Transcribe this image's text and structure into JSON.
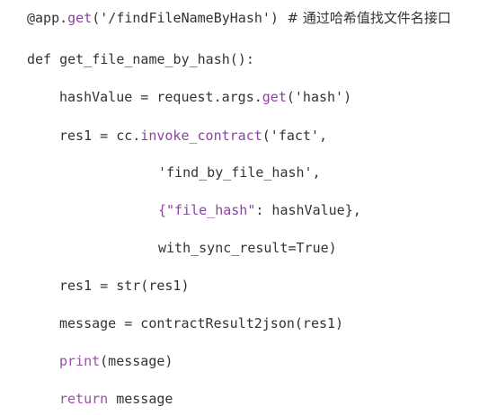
{
  "code": {
    "line0": {
      "decorator": "@app.",
      "method": "get",
      "args": "('/findFileNameByHash')",
      "comment": "  # 通过哈希值找文件名接口"
    },
    "line1": {
      "text": "def get_file_name_by_hash():"
    },
    "line2": {
      "lhs": "hashValue = request.args.",
      "method": "get",
      "args": "('hash')"
    },
    "line3": {
      "lhs": "res1 = cc.",
      "method": "invoke_contract",
      "args": "('fact',"
    },
    "line4": {
      "text": "'find_by_file_hash',"
    },
    "line5": {
      "open": "{",
      "key": "\"file_hash\"",
      "rest": ": hashValue},"
    },
    "line6": {
      "text": "with_sync_result=True)"
    },
    "line7": {
      "text": "res1 = str(res1)"
    },
    "line8": {
      "text": "message = contractResult2json(res1)"
    },
    "line9": {
      "func": "print",
      "args": "(message)"
    },
    "line10": {
      "keyword": "return",
      "rest": " message"
    }
  },
  "colors": {
    "text": "#333333",
    "builtin": "#9a4fa8",
    "background": "#ffffff"
  }
}
